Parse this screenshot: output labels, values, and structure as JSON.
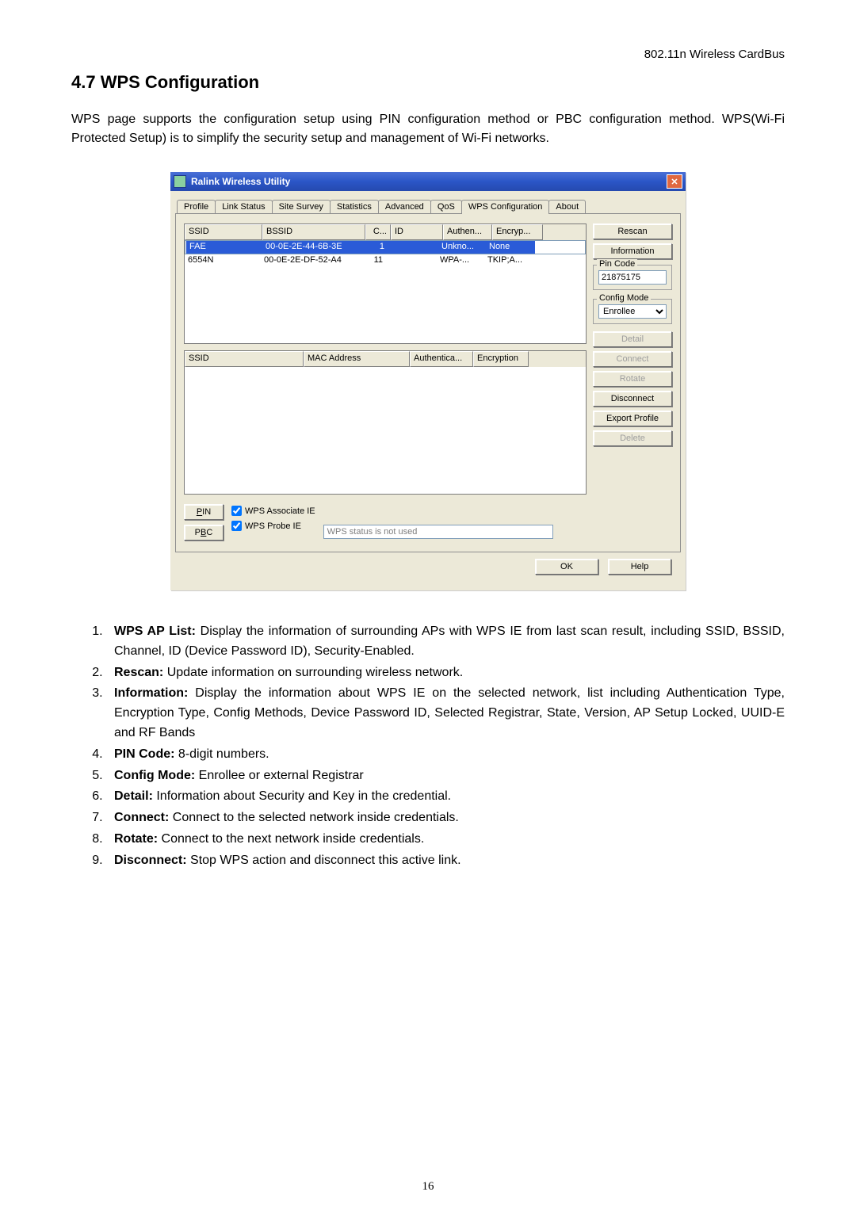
{
  "header": "802.11n Wireless CardBus",
  "heading": "4.7 WPS Configuration",
  "intro": "WPS page supports the configuration setup using PIN configuration method or PBC configuration method.   WPS(Wi-Fi Protected Setup) is to simplify the security setup and management of Wi-Fi networks.",
  "win": {
    "title": "Ralink Wireless Utility",
    "tabs": [
      "Profile",
      "Link Status",
      "Site Survey",
      "Statistics",
      "Advanced",
      "QoS",
      "WPS Configuration",
      "About"
    ],
    "ap_headers": {
      "ssid": "SSID",
      "bssid": "BSSID",
      "c": "C...",
      "id": "ID",
      "authen": "Authen...",
      "encryp": "Encryp..."
    },
    "ap_rows": [
      {
        "ssid": "FAE",
        "bssid": "00-0E-2E-44-6B-3E",
        "c": "1",
        "id": "",
        "auth": "Unkno...",
        "enc": "None"
      },
      {
        "ssid": "6554N",
        "bssid": "00-0E-2E-DF-52-A4",
        "c": "11",
        "id": "",
        "auth": "WPA-...",
        "enc": "TKIP;A..."
      }
    ],
    "cred_headers": {
      "ssid": "SSID",
      "mac": "MAC Address",
      "auth": "Authentica...",
      "enc": "Encryption"
    },
    "buttons": {
      "rescan": "Rescan",
      "information": "Information",
      "pin_group": "Pin Code",
      "pin_value": "21875175",
      "mode_group": "Config Mode",
      "mode_value": "Enrollee",
      "detail": "Detail",
      "connect": "Connect",
      "rotate": "Rotate",
      "disconnect": "Disconnect",
      "export": "Export Profile",
      "delete": "Delete"
    },
    "pin_btn": "PIN",
    "pbc_btn": "PBC",
    "assoc_label": "WPS Associate IE",
    "probe_label": "WPS Probe IE",
    "status": "WPS status is not used",
    "ok": "OK",
    "help": "Help"
  },
  "list": [
    {
      "t": "WPS AP List:",
      "d": " Display the information of surrounding APs with WPS IE from last scan result, including SSID, BSSID, Channel, ID (Device Password ID), Security-Enabled."
    },
    {
      "t": "Rescan:",
      "d": " Update information on surrounding wireless network."
    },
    {
      "t": "Information:",
      "d": " Display the information about WPS IE on the selected network, list including Authentication Type, Encryption Type, Config Methods, Device Password ID, Selected Registrar, State, Version, AP Setup Locked, UUID-E and RF Bands"
    },
    {
      "t": "PIN Code:",
      "d": " 8-digit numbers."
    },
    {
      "t": "Config Mode:",
      "d": " Enrollee or external Registrar"
    },
    {
      "t": "Detail:",
      "d": " Information about Security and Key in the credential."
    },
    {
      "t": "Connect:",
      "d": " Connect to the selected network inside credentials."
    },
    {
      "t": "Rotate:",
      "d": " Connect to the next network inside credentials."
    },
    {
      "t": "Disconnect:",
      "d": " Stop WPS action and disconnect this active link."
    }
  ],
  "pageno": "16"
}
